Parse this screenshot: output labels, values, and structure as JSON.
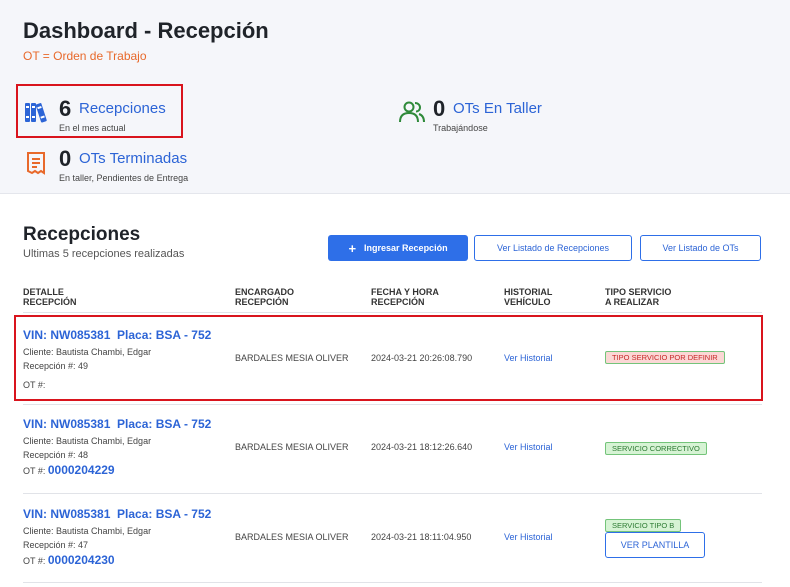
{
  "header": {
    "title": "Dashboard - Recepción",
    "subtitle": "OT = Orden de Trabajo"
  },
  "stats": [
    {
      "icon": "books-icon",
      "value": "6",
      "label": "Recepciones",
      "sub": "En el mes actual"
    },
    {
      "icon": "users-icon",
      "value": "0",
      "label": "OTs En Taller",
      "sub": "Trabajándose"
    },
    {
      "icon": "receipt-icon",
      "value": "0",
      "label": "OTs Terminadas",
      "sub": "En taller, Pendientes de Entrega"
    }
  ],
  "section": {
    "title": "Recepciones",
    "subtitle": "Ultimas 5 recepciones realizadas",
    "btn_ingresar": "Ingresar Recepción",
    "btn_listado_recepciones": "Ver Listado de Recepciones",
    "btn_listado_ots": "Ver Listado de OTs"
  },
  "table": {
    "headers": [
      [
        "DETALLE",
        "RECEPCIÓN"
      ],
      [
        "ENCARGADO",
        "RECEPCIÓN"
      ],
      [
        "FECHA Y HORA",
        "RECEPCIÓN"
      ],
      [
        "HISTORIAL",
        "VEHÍCULO"
      ],
      [
        "TIPO SERVICIO",
        "A REALIZAR"
      ]
    ],
    "rows": [
      {
        "vin": "VIN: NW085381",
        "placa": "Placa: BSA - 752",
        "cliente": "Cliente: Bautista Chambi, Edgar",
        "recepcion": "Recepción #: 49",
        "ot_label": "OT #:",
        "ot_value": "",
        "encargado": "BARDALES MESIA OLIVER",
        "fecha": "2024-03-21 20:26:08.790",
        "historial": "Ver Historial",
        "tipo": "TIPO SERVICIO POR DEFINIR",
        "tipo_color": "#fbd7d5"
      },
      {
        "vin": "VIN: NW085381",
        "placa": "Placa: BSA - 752",
        "cliente": "Cliente: Bautista Chambi, Edgar",
        "recepcion": "Recepción #: 48",
        "ot_label": "OT #:",
        "ot_value": "0000204229",
        "encargado": "BARDALES MESIA OLIVER",
        "fecha": "2024-03-21 18:12:26.640",
        "historial": "Ver Historial",
        "tipo": "SERVICIO CORRECTIVO",
        "tipo_color": "#d6f3d4"
      },
      {
        "vin": "VIN: NW085381",
        "placa": "Placa: BSA - 752",
        "cliente": "Cliente: Bautista Chambi, Edgar",
        "recepcion": "Recepción #: 47",
        "ot_label": "OT #:",
        "ot_value": "0000204230",
        "encargado": "BARDALES MESIA OLIVER",
        "fecha": "2024-03-21 18:11:04.950",
        "historial": "Ver Historial",
        "tipo": "SERVICIO TIPO B",
        "tipo_color": "#d6f3d4",
        "btn_plantilla": "VER PLANTILLA"
      }
    ]
  }
}
